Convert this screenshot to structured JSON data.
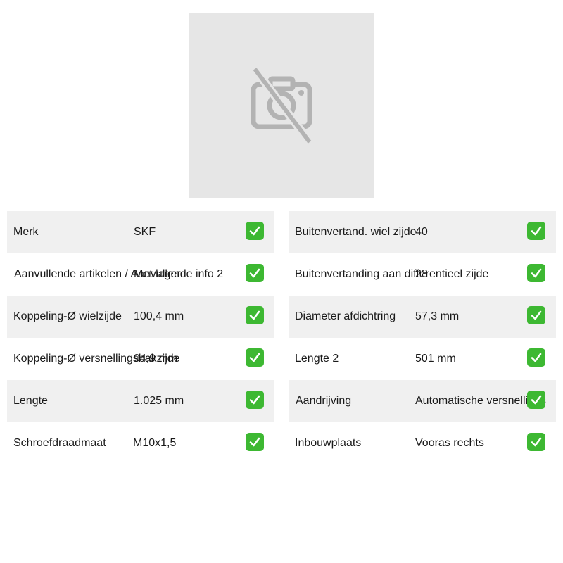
{
  "product_image": {
    "icon": "no-camera-icon"
  },
  "check_icon": "green-check-icon",
  "specs": {
    "left": [
      {
        "label": "Merk",
        "value": "SKF"
      },
      {
        "label": "Aanvullende artikelen / Aanvullende info 2",
        "value": "Met lager"
      },
      {
        "label": "Koppeling-Ø wielzijde",
        "value": "100,4 mm"
      },
      {
        "label": "Koppeling-Ø versnellingsbakzijde",
        "value": "94,9 mm"
      },
      {
        "label": "Lengte",
        "value": "1.025 mm"
      },
      {
        "label": "Schroefdraadmaat",
        "value": "M10x1,5"
      }
    ],
    "right": [
      {
        "label": "Buitenvertand. wiel zijde",
        "value": "40"
      },
      {
        "label": "Buitenvertanding aan differentieel zijde",
        "value": "28"
      },
      {
        "label": "Diameter afdichtring",
        "value": "57,3 mm"
      },
      {
        "label": "Lengte 2",
        "value": "501 mm"
      },
      {
        "label": "Aandrijving",
        "value": "Automatische versnellings"
      },
      {
        "label": "Inbouwplaats",
        "value": "Vooras rechts"
      }
    ]
  }
}
